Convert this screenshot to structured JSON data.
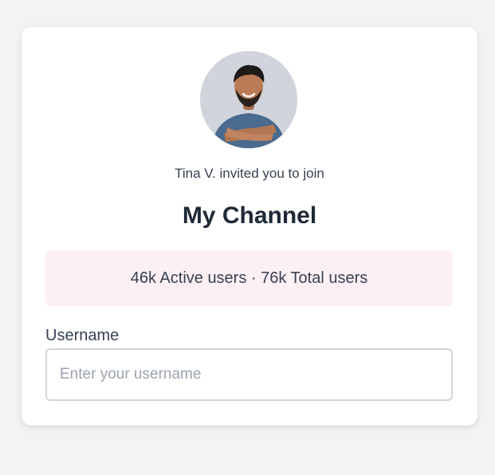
{
  "invite": {
    "avatar_icon": "person-avatar-icon",
    "text": "Tina V. invited you to join"
  },
  "channel": {
    "name": "My Channel"
  },
  "stats": {
    "text": "46k Active users · 76k Total users"
  },
  "form": {
    "username_label": "Username",
    "username_value": "",
    "username_placeholder": "Enter your username"
  },
  "colors": {
    "page_background": "#f2f3f5",
    "card_background": "#ffffff",
    "stats_background": "#fdf0f5",
    "title_text": "#1f2937",
    "body_text": "#374151",
    "input_border": "#d1d5db",
    "placeholder_text": "#9ca3af"
  }
}
